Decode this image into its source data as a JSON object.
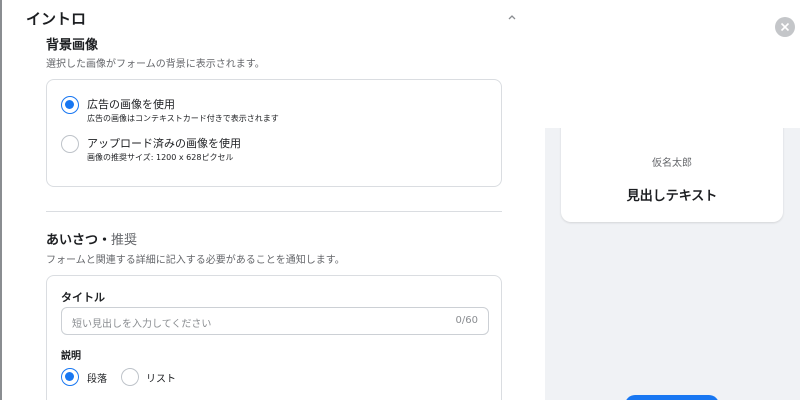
{
  "intro": {
    "title": "イントロ"
  },
  "background_image": {
    "title": "背景画像",
    "subtitle": "選択した画像がフォームの背景に表示されます。",
    "options": [
      {
        "label": "広告の画像を使用",
        "sub": "広告の画像はコンテキストカード付きで表示されます",
        "selected": true
      },
      {
        "label": "アップロード済みの画像を使用",
        "sub": "画像の推奨サイズ: 1200 x 628ピクセル",
        "selected": false
      }
    ]
  },
  "greeting": {
    "title": "あいさつ",
    "separator": "・",
    "recommended": "推奨",
    "subtitle": "フォームと関連する詳細に記入する必要があることを通知します。",
    "title_field": {
      "label": "タイトル",
      "placeholder": "短い見出しを入力してください",
      "counter": "0/60"
    },
    "description_label": "説明",
    "format_options": [
      {
        "label": "段落",
        "selected": true
      },
      {
        "label": "リスト",
        "selected": false
      }
    ]
  },
  "preview": {
    "name": "仮名太郎",
    "headline": "見出しテキスト"
  },
  "colors": {
    "accent": "#1877f2",
    "border": "#dadde1",
    "preview_bg": "#f0f2f5"
  }
}
